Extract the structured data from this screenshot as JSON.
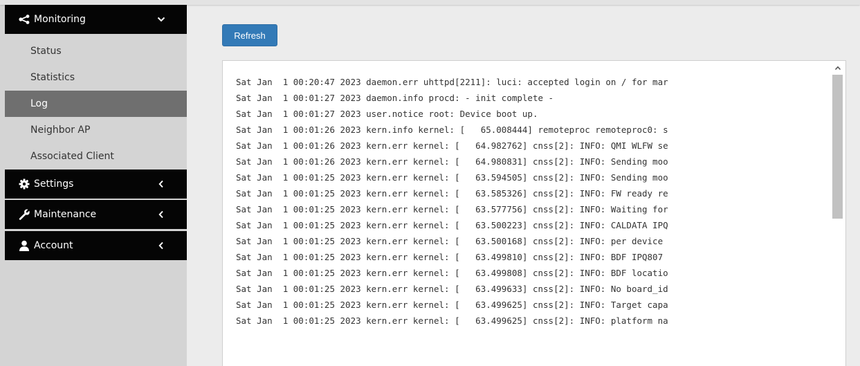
{
  "sidebar": {
    "monitoring": {
      "label": "Monitoring",
      "icon": "share-icon",
      "caret": "chevron-down-icon"
    },
    "monitoring_items": [
      {
        "label": "Status",
        "active": false
      },
      {
        "label": "Statistics",
        "active": false
      },
      {
        "label": "Log",
        "active": true
      },
      {
        "label": "Neighbor AP",
        "active": false
      },
      {
        "label": "Associated Client",
        "active": false
      }
    ],
    "settings": {
      "label": "Settings",
      "icon": "gear-icon",
      "caret": "chevron-left-icon"
    },
    "maintenance": {
      "label": "Maintenance",
      "icon": "wrench-icon",
      "caret": "chevron-left-icon"
    },
    "account": {
      "label": "Account",
      "icon": "user-icon",
      "caret": "chevron-left-icon"
    }
  },
  "main": {
    "refresh_label": "Refresh",
    "log_lines": [
      "Sat Jan  1 00:20:47 2023 daemon.err uhttpd[2211]: luci: accepted login on / for mar",
      "Sat Jan  1 00:01:27 2023 daemon.info procd: - init complete -",
      "Sat Jan  1 00:01:27 2023 user.notice root: Device boot up.",
      "Sat Jan  1 00:01:26 2023 kern.info kernel: [   65.008444] remoteproc remoteproc0: s",
      "Sat Jan  1 00:01:26 2023 kern.err kernel: [   64.982762] cnss[2]: INFO: QMI WLFW se",
      "Sat Jan  1 00:01:26 2023 kern.err kernel: [   64.980831] cnss[2]: INFO: Sending moo",
      "Sat Jan  1 00:01:25 2023 kern.err kernel: [   63.594505] cnss[2]: INFO: Sending moo",
      "Sat Jan  1 00:01:25 2023 kern.err kernel: [   63.585326] cnss[2]: INFO: FW ready re",
      "Sat Jan  1 00:01:25 2023 kern.err kernel: [   63.577756] cnss[2]: INFO: Waiting for",
      "Sat Jan  1 00:01:25 2023 kern.err kernel: [   63.500223] cnss[2]: INFO: CALDATA IPQ",
      "Sat Jan  1 00:01:25 2023 kern.err kernel: [   63.500168] cnss[2]: INFO: per device",
      "Sat Jan  1 00:01:25 2023 kern.err kernel: [   63.499810] cnss[2]: INFO: BDF IPQ807",
      "Sat Jan  1 00:01:25 2023 kern.err kernel: [   63.499808] cnss[2]: INFO: BDF locatio",
      "Sat Jan  1 00:01:25 2023 kern.err kernel: [   63.499633] cnss[2]: INFO: No board_id",
      "Sat Jan  1 00:01:25 2023 kern.err kernel: [   63.499625] cnss[2]: INFO: Target capa",
      "Sat Jan  1 00:01:25 2023 kern.err kernel: [   63.499625] cnss[2]: INFO: platform na"
    ]
  },
  "colors": {
    "header_bg": "#050505",
    "active_item_bg": "#6f6f6f",
    "sidebar_bg": "#d4d4d4",
    "button_bg": "#337ab7"
  }
}
